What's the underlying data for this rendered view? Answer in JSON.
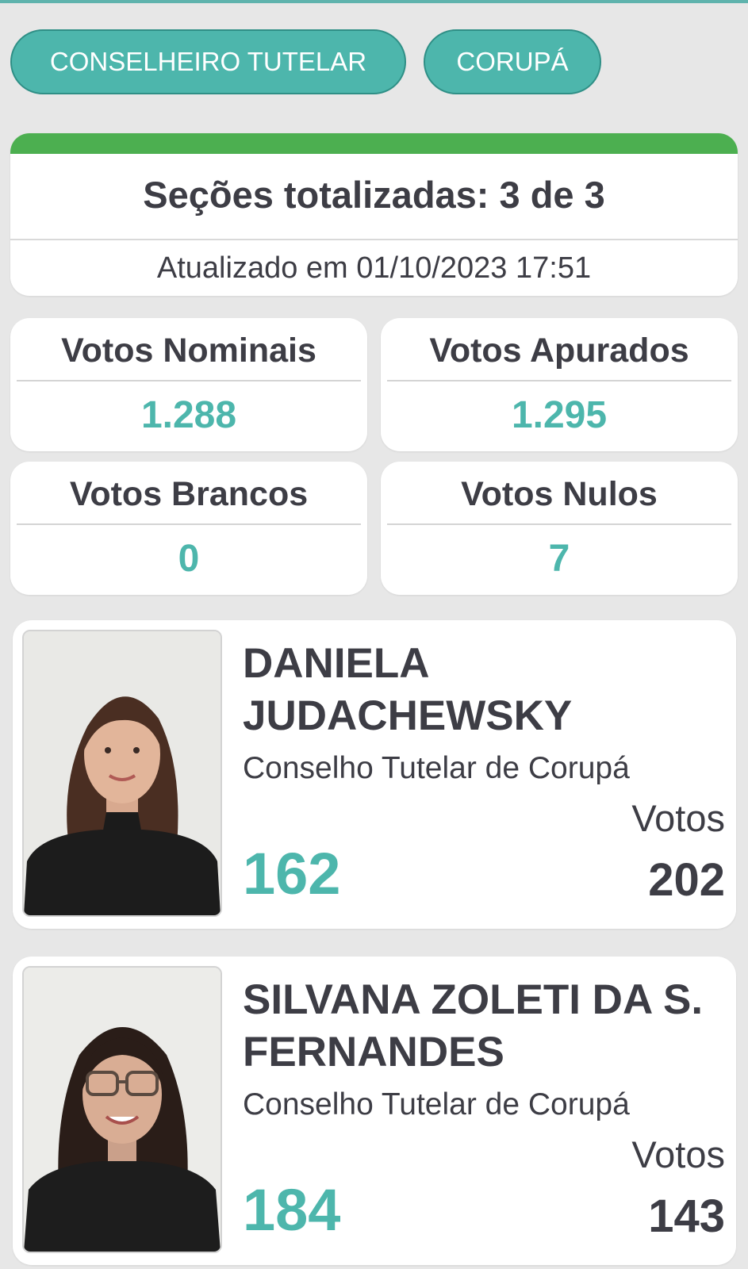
{
  "filters": {
    "cargo_label": "CONSELHEIRO TUTELAR",
    "municipio_label": "CORUPÁ"
  },
  "sections": {
    "title": "Seções totalizadas: 3 de 3",
    "updated": "Atualizado em 01/10/2023 17:51",
    "progress_fraction": 1.0,
    "progress_color": "#4caf50"
  },
  "stats": {
    "nominais": {
      "label": "Votos Nominais",
      "value": "1.288"
    },
    "apurados": {
      "label": "Votos Apurados",
      "value": "1.295"
    },
    "brancos": {
      "label": "Votos Brancos",
      "value": "0"
    },
    "nulos": {
      "label": "Votos Nulos",
      "value": "7"
    }
  },
  "candidates": [
    {
      "name": "DANIELA JUDACHEWSKY",
      "organization": "Conselho Tutelar de Corupá",
      "votes_label": "Votos",
      "number": "162",
      "votes": "202"
    },
    {
      "name": "SILVANA ZOLETI DA S. FERNANDES",
      "organization": "Conselho Tutelar de Corupá",
      "votes_label": "Votos",
      "number": "184",
      "votes": "143"
    }
  ],
  "colors": {
    "accent": "#4db6ac",
    "text": "#3d3d45",
    "background": "#e7e7e7"
  }
}
